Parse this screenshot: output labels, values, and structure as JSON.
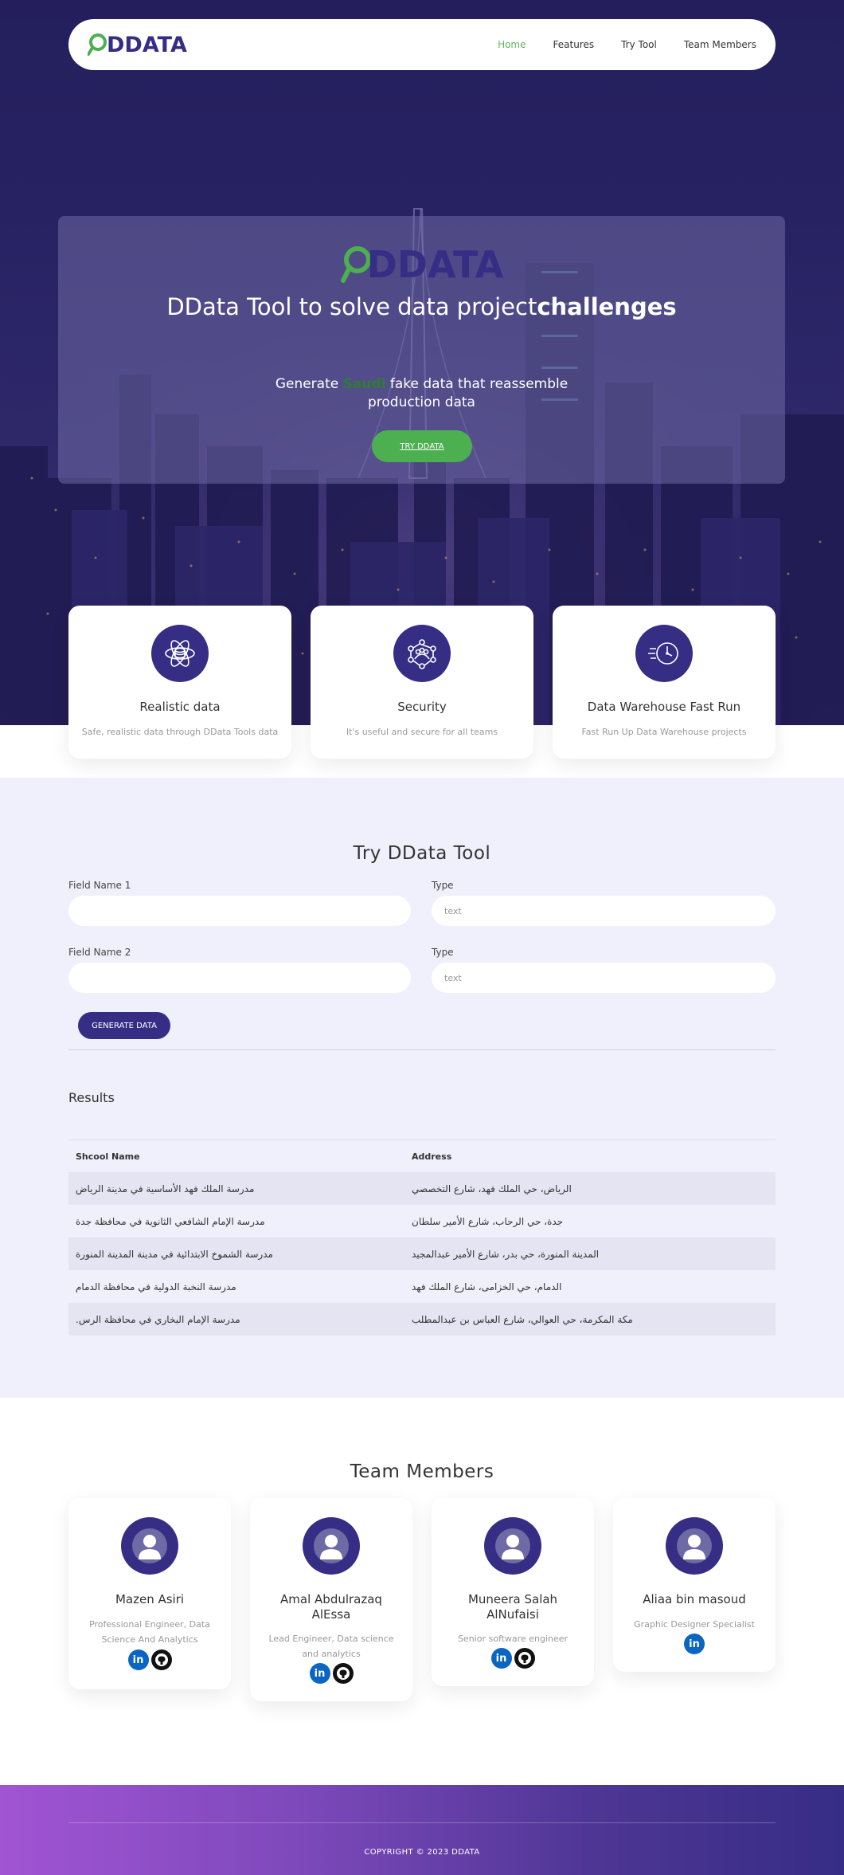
{
  "nav": {
    "logo": "DDATA",
    "links": [
      "Home",
      "Features",
      "Try Tool",
      "Team Members"
    ]
  },
  "hero": {
    "logo": "DDATA",
    "title_plain": "DData Tool to solve data project",
    "title_bold": "challenges",
    "subtitle_before": "Generate ",
    "subtitle_highlight": "Saudi",
    "subtitle_after": " fake data that reassemble production data",
    "button": "TRY DDATA"
  },
  "features": [
    {
      "title": "Realistic data",
      "desc": "Safe, realistic data through DData Tools data",
      "icon": "atom-database-icon"
    },
    {
      "title": "Security",
      "desc": "It's useful and secure for all teams",
      "icon": "network-people-icon"
    },
    {
      "title": "Data Warehouse Fast Run",
      "desc": "Fast Run Up Data Warehouse projects",
      "icon": "fast-clock-icon"
    }
  ],
  "try_tool": {
    "title": "Try DData Tool",
    "field1_label": "Field Name 1",
    "field2_label": "Field Name 2",
    "type_label": "Type",
    "type1_value": "text",
    "type2_value": "text",
    "generate_button": "GENERATE DATA",
    "results_title": "Results",
    "columns": [
      "Shcool Name",
      "Address"
    ],
    "rows": [
      [
        "مدرسة الملك فهد الأساسية في مدينة الرياض",
        "الرياض، حي الملك فهد، شارع التخصصي"
      ],
      [
        "مدرسة الإمام الشافعي الثانوية في محافظة جدة",
        "جدة، حي الرحاب، شارع الأمير سلطان"
      ],
      [
        "مدرسة الشموخ الابتدائية في مدينة المدينة المنورة",
        "المدينة المنورة، حي بدر، شارع الأمير عبدالمجيد"
      ],
      [
        "مدرسة النخبة الدولية في محافظة الدمام",
        "الدمام، حي الخزامى، شارع الملك فهد"
      ],
      [
        "مدرسة الإمام البخاري في محافظة الرس.",
        "مكة المكرمة، حي العوالي، شارع العباس بن عبدالمطلب"
      ]
    ]
  },
  "team": {
    "title": "Team Members",
    "members": [
      {
        "name": "Mazen Asiri",
        "role": "Professional Engineer, Data Science And Analytics",
        "linkedin": true,
        "github": true
      },
      {
        "name": "Amal Abdulrazaq AlEssa",
        "role": "Lead Engineer, Data science and analytics",
        "linkedin": true,
        "github": true
      },
      {
        "name": "Muneera Salah AlNufaisi",
        "role": "Senior software engineer",
        "linkedin": true,
        "github": true
      },
      {
        "name": "Aliaa bin masoud",
        "role": "Graphic Designer Specialist",
        "linkedin": true,
        "github": false
      }
    ]
  },
  "footer": {
    "copyright": "COPYRIGHT © 2023 DDATA"
  },
  "colors": {
    "brand": "#362d85",
    "accent": "#4caf50",
    "nav_active": "#5cb85c"
  }
}
